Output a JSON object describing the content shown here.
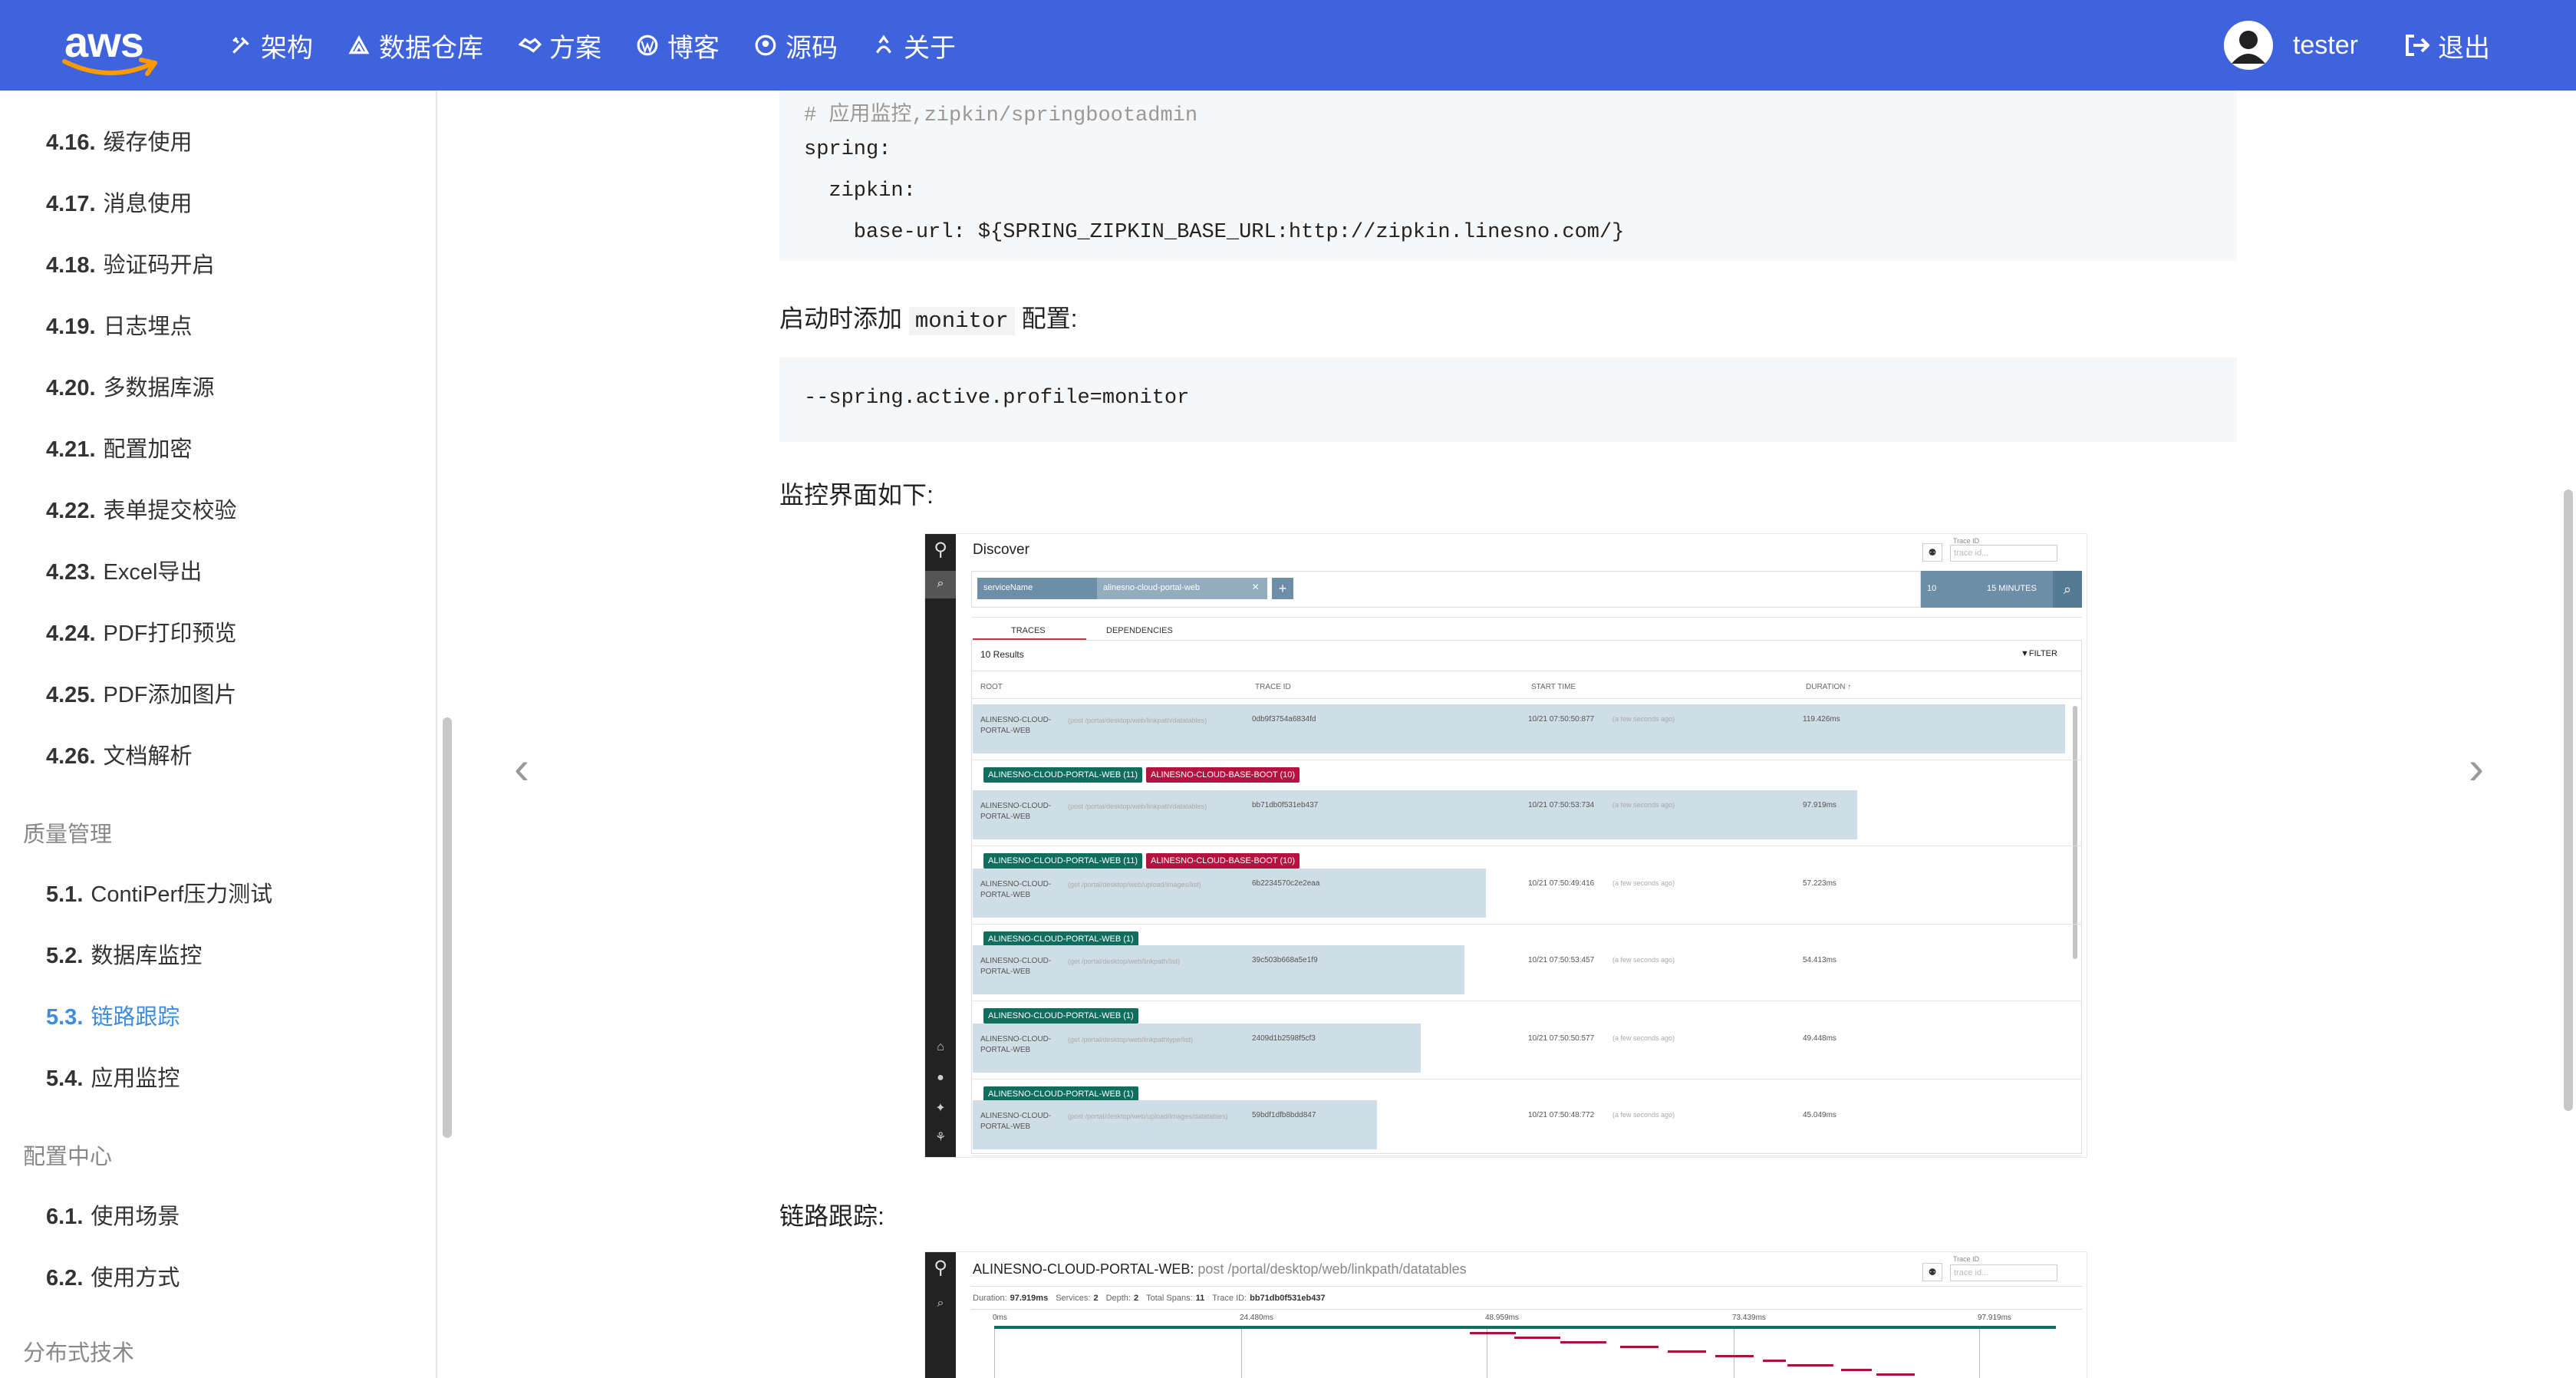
{
  "header": {
    "logo": "aws",
    "nav": [
      {
        "label": "架构",
        "icon": "tools-icon"
      },
      {
        "label": "数据仓库",
        "icon": "warehouse-icon"
      },
      {
        "label": "方案",
        "icon": "handshake-icon"
      },
      {
        "label": "博客",
        "icon": "wordpress-icon"
      },
      {
        "label": "源码",
        "icon": "github-icon"
      },
      {
        "label": "关于",
        "icon": "user-secret-icon"
      }
    ],
    "username": "tester",
    "logout": "退出"
  },
  "sidebar": {
    "items": [
      {
        "num": "4.16.",
        "label": "缓存使用"
      },
      {
        "num": "4.17.",
        "label": "消息使用"
      },
      {
        "num": "4.18.",
        "label": "验证码开启"
      },
      {
        "num": "4.19.",
        "label": "日志埋点"
      },
      {
        "num": "4.20.",
        "label": "多数据库源"
      },
      {
        "num": "4.21.",
        "label": "配置加密"
      },
      {
        "num": "4.22.",
        "label": "表单提交校验"
      },
      {
        "num": "4.23.",
        "label": "Excel导出"
      },
      {
        "num": "4.24.",
        "label": "PDF打印预览"
      },
      {
        "num": "4.25.",
        "label": "PDF添加图片"
      },
      {
        "num": "4.26.",
        "label": "文档解析"
      }
    ],
    "section_quality": "质量管理",
    "quality_items": [
      {
        "num": "5.1.",
        "label": "ContiPerf压力测试"
      },
      {
        "num": "5.2.",
        "label": "数据库监控"
      },
      {
        "num": "5.3.",
        "label": "链路跟踪"
      },
      {
        "num": "5.4.",
        "label": "应用监控"
      }
    ],
    "section_config": "配置中心",
    "config_items": [
      {
        "num": "6.1.",
        "label": "使用场景"
      },
      {
        "num": "6.2.",
        "label": "使用方式"
      }
    ],
    "section_distributed": "分布式技术"
  },
  "content": {
    "code1": [
      "# 应用监控,zipkin/springbootadmin",
      "spring:",
      "  zipkin:",
      "    base-url: ${SPRING_ZIPKIN_BASE_URL:http://zipkin.linesno.com/}"
    ],
    "para1_pre": "启动时添加",
    "para1_code": "monitor",
    "para1_post": "配置:",
    "code2": "--spring.active.profile=monitor",
    "para2": "监控界面如下:",
    "para3": "链路跟踪:",
    "prev_arrow": "‹",
    "next_arrow": "›"
  },
  "zipkin": {
    "title": "Discover",
    "trace_id_label": "Trace ID",
    "trace_id_placeholder": "trace id...",
    "filter_key": "serviceName",
    "filter_value": "alinesno-cloud-portal-web",
    "limit": "10",
    "lookback": "15 MINUTES",
    "tabs": [
      "TRACES",
      "DEPENDENCIES"
    ],
    "results": "10 Results",
    "filter_btn": "FILTER",
    "columns": [
      "ROOT",
      "TRACE ID",
      "START TIME",
      "DURATION ↑"
    ],
    "rows": [
      {
        "root": "ALINESNO-CLOUD-PORTAL-WEB",
        "path": "(post /portal/desktop/web/linkpath/datatables)",
        "trace": "0db9f3754a6834fd",
        "start": "10/21 07:50:50:877",
        "ago": "(a few seconds ago)",
        "duration": "119.426ms",
        "fill": 1.0,
        "tags": [
          {
            "t": "ALINESNO-CLOUD-PORTAL-WEB (11)",
            "c": "green"
          },
          {
            "t": "ALINESNO-CLOUD-BASE-BOOT (10)",
            "c": "red"
          }
        ]
      },
      {
        "root": "ALINESNO-CLOUD-PORTAL-WEB",
        "path": "(post /portal/desktop/web/linkpath/datatables)",
        "trace": "bb71db0f531eb437",
        "start": "10/21 07:50:53:734",
        "ago": "(a few seconds ago)",
        "duration": "97.919ms",
        "fill": 0.81,
        "tags": [
          {
            "t": "ALINESNO-CLOUD-PORTAL-WEB (11)",
            "c": "green"
          },
          {
            "t": "ALINESNO-CLOUD-BASE-BOOT (10)",
            "c": "red"
          }
        ]
      },
      {
        "root": "ALINESNO-CLOUD-PORTAL-WEB",
        "path": "(get /portal/desktop/web/upload/images/list)",
        "trace": "6b2234570c2e2eaa",
        "start": "10/21 07:50:49:416",
        "ago": "(a few seconds ago)",
        "duration": "57.223ms",
        "fill": 0.47,
        "tags": [
          {
            "t": "ALINESNO-CLOUD-PORTAL-WEB (1)",
            "c": "green"
          }
        ]
      },
      {
        "root": "ALINESNO-CLOUD-PORTAL-WEB",
        "path": "(get /portal/desktop/web/linkpath/list)",
        "trace": "39c503b668a5e1f9",
        "start": "10/21 07:50:53:457",
        "ago": "(a few seconds ago)",
        "duration": "54.413ms",
        "fill": 0.45,
        "tags": [
          {
            "t": "ALINESNO-CLOUD-PORTAL-WEB (1)",
            "c": "green"
          }
        ]
      },
      {
        "root": "ALINESNO-CLOUD-PORTAL-WEB",
        "path": "(get /portal/desktop/web/linkpathtype/list)",
        "trace": "2409d1b2598f5cf3",
        "start": "10/21 07:50:50:577",
        "ago": "(a few seconds ago)",
        "duration": "49.448ms",
        "fill": 0.41,
        "tags": [
          {
            "t": "ALINESNO-CLOUD-PORTAL-WEB (1)",
            "c": "green"
          }
        ]
      },
      {
        "root": "ALINESNO-CLOUD-PORTAL-WEB",
        "path": "(post /portal/desktop/web/upload/images/datatables)",
        "trace": "59bdf1dfb8bdd847",
        "start": "10/21 07:50:48:772",
        "ago": "(a few seconds ago)",
        "duration": "45.049ms",
        "fill": 0.37,
        "tags": []
      }
    ]
  },
  "zipkin2": {
    "service": "ALINESNO-CLOUD-PORTAL-WEB:",
    "path": "post /portal/desktop/web/linkpath/datatables",
    "trace_id_label": "Trace ID",
    "trace_id_placeholder": "trace id...",
    "summary": [
      {
        "k": "Duration:",
        "v": "97.919ms"
      },
      {
        "k": "Services:",
        "v": "2"
      },
      {
        "k": "Depth:",
        "v": "2"
      },
      {
        "k": "Total Spans:",
        "v": "11"
      },
      {
        "k": "Trace ID:",
        "v": "bb71db0f531eb437"
      }
    ],
    "ticks": [
      "0ms",
      "24.480ms",
      "48.959ms",
      "73.439ms",
      "97.919ms"
    ]
  }
}
